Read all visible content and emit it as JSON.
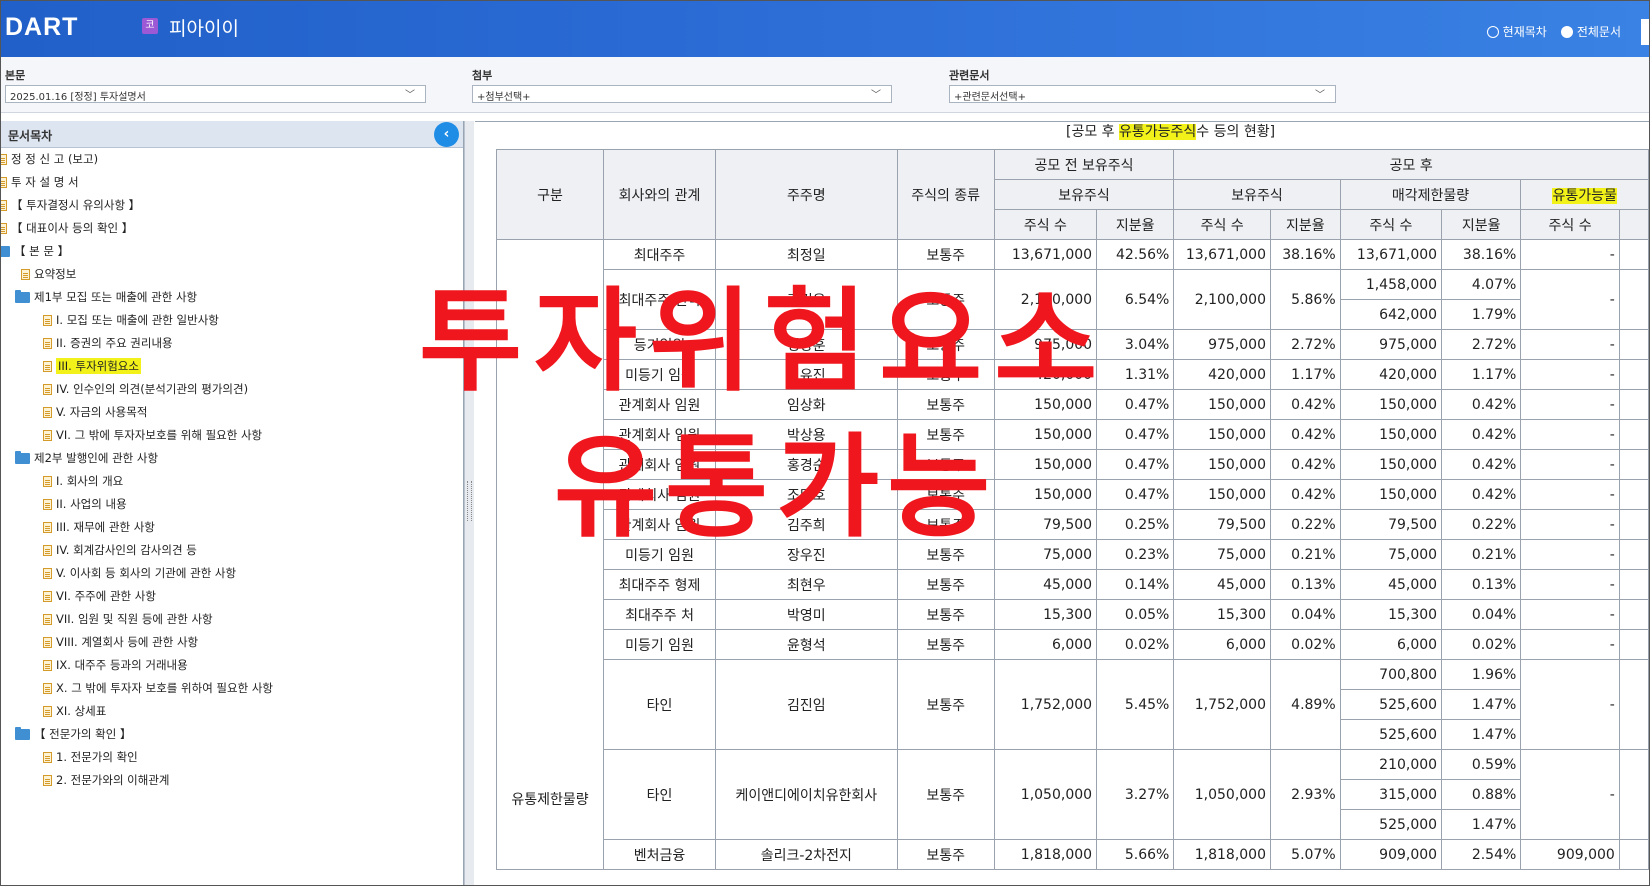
{
  "header": {
    "logo": "DART",
    "company_badge": "코",
    "company_name": "피아이이",
    "view_options": [
      {
        "label": "현재목차",
        "selected": false
      },
      {
        "label": "전체문서",
        "selected": true
      }
    ]
  },
  "selectors": {
    "main": {
      "label": "본문",
      "value": "2025.01.16 [정정] 투자설명서"
    },
    "attach": {
      "label": "첨부",
      "value": "+첨부선택+"
    },
    "related": {
      "label": "관련문서",
      "value": "+관련문서선택+"
    }
  },
  "sidebar": {
    "title": "문서목차",
    "items": [
      {
        "label": "정 정 신 고 (보고)"
      },
      {
        "label": "투 자 설 명 서"
      },
      {
        "label": "【 투자결정시 유의사항 】"
      },
      {
        "label": "【 대표이사 등의 확인 】"
      },
      {
        "label": "【 본 문 】"
      },
      {
        "label": "요약정보"
      },
      {
        "label": "제1부 모집 또는 매출에 관한 사항"
      },
      {
        "label": "I. 모집 또는 매출에 관한 일반사항"
      },
      {
        "label": "II. 증권의 주요 권리내용"
      },
      {
        "label": "III. 투자위험요소",
        "highlight": true
      },
      {
        "label": "IV. 인수인의 의견(분석기관의 평가의견)"
      },
      {
        "label": "V. 자금의 사용목적"
      },
      {
        "label": "VI. 그 밖에 투자자보호를 위해 필요한 사항"
      },
      {
        "label": "제2부 발행인에 관한 사항"
      },
      {
        "label": "I. 회사의 개요"
      },
      {
        "label": "II. 사업의 내용"
      },
      {
        "label": "III. 재무에 관한 사항"
      },
      {
        "label": "IV. 회계감사인의 감사의견 등"
      },
      {
        "label": "V. 이사회 등 회사의 기관에 관한 사항"
      },
      {
        "label": "VI. 주주에 관한 사항"
      },
      {
        "label": "VII. 임원 및 직원 등에 관한 사항"
      },
      {
        "label": "VIII. 계열회사 등에 관한 사항"
      },
      {
        "label": "IX. 대주주 등과의 거래내용"
      },
      {
        "label": "X. 그 밖에 투자자 보호를 위하여 필요한 사항"
      },
      {
        "label": "XI. 상세표"
      },
      {
        "label": "【 전문가의 확인 】"
      },
      {
        "label": "1. 전문가의 확인"
      },
      {
        "label": "2. 전문가와의 이해관계"
      }
    ]
  },
  "table": {
    "title_prefix": "[공모 후 ",
    "title_hl": "유통가능주식",
    "title_suffix": "수 등의 현황]",
    "headers": {
      "category": "구분",
      "relation": "회사와의 관계",
      "holder": "주주명",
      "stock_type": "주식의 종류",
      "pre_offering": "공모 전 보유주식",
      "post_offering": "공모 후",
      "held": "보유주식",
      "held2": "보유주식",
      "lockup": "매각제한물량",
      "tradable": "유통가능물",
      "shares": "주식 수",
      "ratio": "지분율"
    },
    "group_label": "유통제한물량",
    "rows": [
      {
        "rel": "최대주주",
        "name": "최정일",
        "type": "보통주",
        "pre_n": "13,671,000",
        "pre_p": "42.56%",
        "post_n": "13,671,000",
        "post_p": "38.16%",
        "lock": [
          [
            "13,671,000",
            "38.16%"
          ]
        ],
        "trade": "-"
      },
      {
        "rel": "최대주주 인척",
        "name": "김건욱",
        "type": "보통주",
        "pre_n": "2,100,000",
        "pre_p": "6.54%",
        "post_n": "2,100,000",
        "post_p": "5.86%",
        "lock": [
          [
            "1,458,000",
            "4.07%"
          ],
          [
            "642,000",
            "1.79%"
          ]
        ],
        "trade": "-"
      },
      {
        "rel": "등기임원",
        "name": "정양훈",
        "type": "보통주",
        "pre_n": "975,000",
        "pre_p": "3.04%",
        "post_n": "975,000",
        "post_p": "2.72%",
        "lock": [
          [
            "975,000",
            "2.72%"
          ]
        ],
        "trade": "-"
      },
      {
        "rel": "미등기 임원",
        "name": "이유진",
        "type": "보통주",
        "pre_n": "420,000",
        "pre_p": "1.31%",
        "post_n": "420,000",
        "post_p": "1.17%",
        "lock": [
          [
            "420,000",
            "1.17%"
          ]
        ],
        "trade": "-"
      },
      {
        "rel": "관계회사 임원",
        "name": "임상화",
        "type": "보통주",
        "pre_n": "150,000",
        "pre_p": "0.47%",
        "post_n": "150,000",
        "post_p": "0.42%",
        "lock": [
          [
            "150,000",
            "0.42%"
          ]
        ],
        "trade": "-"
      },
      {
        "rel": "관계회사 임원",
        "name": "박상용",
        "type": "보통주",
        "pre_n": "150,000",
        "pre_p": "0.47%",
        "post_n": "150,000",
        "post_p": "0.42%",
        "lock": [
          [
            "150,000",
            "0.42%"
          ]
        ],
        "trade": "-"
      },
      {
        "rel": "관계회사 임원",
        "name": "홍경순",
        "type": "보통주",
        "pre_n": "150,000",
        "pre_p": "0.47%",
        "post_n": "150,000",
        "post_p": "0.42%",
        "lock": [
          [
            "150,000",
            "0.42%"
          ]
        ],
        "trade": "-"
      },
      {
        "rel": "관계회사 임원",
        "name": "조민호",
        "type": "보통주",
        "pre_n": "150,000",
        "pre_p": "0.47%",
        "post_n": "150,000",
        "post_p": "0.42%",
        "lock": [
          [
            "150,000",
            "0.42%"
          ]
        ],
        "trade": "-"
      },
      {
        "rel": "관계회사 임원",
        "name": "김주희",
        "type": "보통주",
        "pre_n": "79,500",
        "pre_p": "0.25%",
        "post_n": "79,500",
        "post_p": "0.22%",
        "lock": [
          [
            "79,500",
            "0.22%"
          ]
        ],
        "trade": "-"
      },
      {
        "rel": "미등기 임원",
        "name": "장우진",
        "type": "보통주",
        "pre_n": "75,000",
        "pre_p": "0.23%",
        "post_n": "75,000",
        "post_p": "0.21%",
        "lock": [
          [
            "75,000",
            "0.21%"
          ]
        ],
        "trade": "-"
      },
      {
        "rel": "최대주주 형제",
        "name": "최현우",
        "type": "보통주",
        "pre_n": "45,000",
        "pre_p": "0.14%",
        "post_n": "45,000",
        "post_p": "0.13%",
        "lock": [
          [
            "45,000",
            "0.13%"
          ]
        ],
        "trade": "-"
      },
      {
        "rel": "최대주주 처",
        "name": "박영미",
        "type": "보통주",
        "pre_n": "15,300",
        "pre_p": "0.05%",
        "post_n": "15,300",
        "post_p": "0.04%",
        "lock": [
          [
            "15,300",
            "0.04%"
          ]
        ],
        "trade": "-"
      },
      {
        "rel": "미등기 임원",
        "name": "윤형석",
        "type": "보통주",
        "pre_n": "6,000",
        "pre_p": "0.02%",
        "post_n": "6,000",
        "post_p": "0.02%",
        "lock": [
          [
            "6,000",
            "0.02%"
          ]
        ],
        "trade": "-"
      },
      {
        "rel": "타인",
        "name": "김진임",
        "type": "보통주",
        "pre_n": "1,752,000",
        "pre_p": "5.45%",
        "post_n": "1,752,000",
        "post_p": "4.89%",
        "lock": [
          [
            "700,800",
            "1.96%"
          ],
          [
            "525,600",
            "1.47%"
          ],
          [
            "525,600",
            "1.47%"
          ]
        ],
        "trade": "-"
      },
      {
        "rel": "타인",
        "name": "케이앤디에이치유한회사",
        "type": "보통주",
        "pre_n": "1,050,000",
        "pre_p": "3.27%",
        "post_n": "1,050,000",
        "post_p": "2.93%",
        "lock": [
          [
            "210,000",
            "0.59%"
          ],
          [
            "315,000",
            "0.88%"
          ],
          [
            "525,000",
            "1.47%"
          ]
        ],
        "trade": "-"
      },
      {
        "rel": "벤처금융",
        "name": "솔리크-2차전지",
        "type": "보통주",
        "pre_n": "1,818,000",
        "pre_p": "5.66%",
        "post_n": "1,818,000",
        "post_p": "5.07%",
        "lock": [
          [
            "909,000",
            "2.54%"
          ]
        ],
        "trade": "909,000"
      }
    ]
  },
  "overlay": {
    "line1": "투자위험요소",
    "line2": "유통가능"
  },
  "colors": {
    "overlay": "#f0161d",
    "highlight": "#f2f21a",
    "header_blue": "#2a6ad4"
  }
}
